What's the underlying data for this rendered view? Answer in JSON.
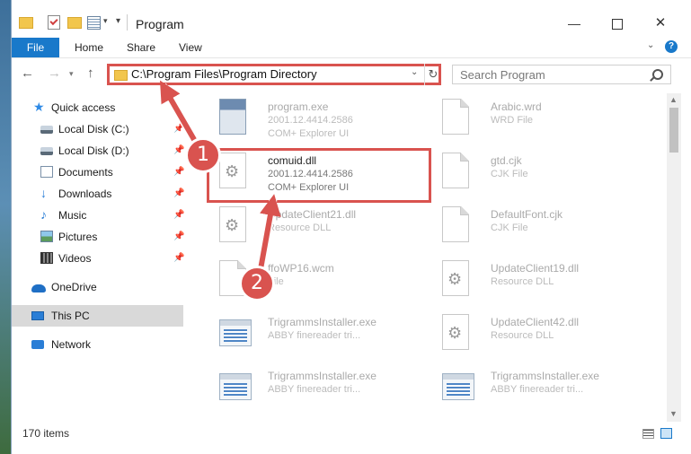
{
  "window": {
    "title": "Program",
    "controls": {
      "minimize": "—",
      "maximize": "",
      "close": "✕"
    }
  },
  "ribbon": {
    "tabs": [
      {
        "label": "File",
        "active": true
      },
      {
        "label": "Home"
      },
      {
        "label": "Share"
      },
      {
        "label": "View"
      }
    ],
    "help": "?"
  },
  "navbar": {
    "address": "C:\\Program Files\\Program Directory",
    "search_placeholder": "Search Program"
  },
  "sidebar": {
    "items": [
      {
        "label": "Quick access",
        "icon": "star-icon"
      },
      {
        "label": "Local Disk (C:)",
        "icon": "disk-icon",
        "pinned": true
      },
      {
        "label": "Local Disk (D:)",
        "icon": "disk-icon",
        "pinned": true
      },
      {
        "label": "Documents",
        "icon": "documents-icon",
        "pinned": true
      },
      {
        "label": "Downloads",
        "icon": "download-icon",
        "pinned": true
      },
      {
        "label": "Music",
        "icon": "music-icon",
        "pinned": true
      },
      {
        "label": "Pictures",
        "icon": "pictures-icon",
        "pinned": true
      },
      {
        "label": "Videos",
        "icon": "video-icon",
        "pinned": true
      },
      {
        "label": "OneDrive",
        "icon": "cloud-icon"
      },
      {
        "label": "This PC",
        "icon": "computer-icon",
        "selected": true
      },
      {
        "label": "Network",
        "icon": "network-icon"
      }
    ]
  },
  "files": [
    {
      "name": "program.exe",
      "line1": "2001.12.4414.2586",
      "line2": "COM+ Explorer UI",
      "icon": "program-icon"
    },
    {
      "name": "Arabic.wrd",
      "line1": "WRD File",
      "line2": "",
      "icon": "document-icon"
    },
    {
      "name": "comuid.dll",
      "line1": "2001.12.4414.2586",
      "line2": "COM+ Explorer UI",
      "icon": "gear-file-icon",
      "highlighted": true
    },
    {
      "name": "gtd.cjk",
      "line1": "CJK File",
      "line2": "",
      "icon": "document-icon"
    },
    {
      "name": "UpdateClient21.dll",
      "line1": "Resource DLL",
      "line2": "",
      "icon": "gear-file-icon"
    },
    {
      "name": "DefaultFont.cjk",
      "line1": "CJK File",
      "line2": "",
      "icon": "document-icon"
    },
    {
      "name": "ffoWP16.wcm",
      "line1": "File",
      "line2": "",
      "icon": "document-icon"
    },
    {
      "name": "UpdateClient19.dll",
      "line1": "Resource DLL",
      "line2": "",
      "icon": "gear-file-icon"
    },
    {
      "name": "TrigrammsInstaller.exe",
      "line1": "ABBY finereader tri...",
      "line2": "",
      "icon": "window-exe-icon"
    },
    {
      "name": "UpdateClient42.dll",
      "line1": "Resource DLL",
      "line2": "",
      "icon": "gear-file-icon"
    },
    {
      "name": "TrigrammsInstaller.exe",
      "line1": "ABBY finereader tri...",
      "line2": "",
      "icon": "window-exe-icon"
    },
    {
      "name": "TrigrammsInstaller.exe",
      "line1": "ABBY finereader tri...",
      "line2": "",
      "icon": "window-exe-icon"
    }
  ],
  "status": {
    "count": "170 items"
  },
  "annotations": {
    "step1": "1",
    "step2": "2",
    "color": "#d9534f"
  }
}
